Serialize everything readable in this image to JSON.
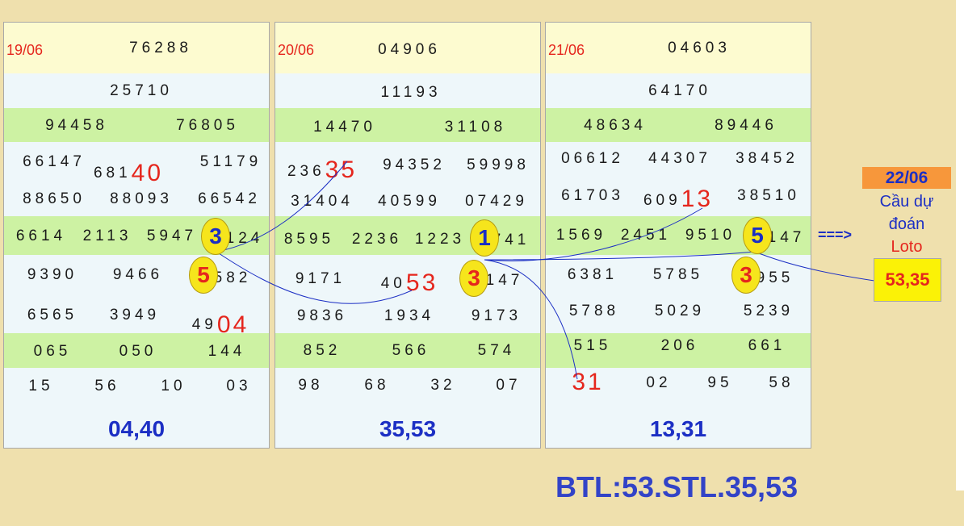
{
  "panels": [
    {
      "date": "19/06",
      "special": "76288",
      "first": "25710",
      "second": [
        "94458",
        "76805"
      ],
      "third_a": [
        "66147",
        "681",
        "40",
        "51179"
      ],
      "third_b": [
        "88650",
        "88093",
        "66542"
      ],
      "fourth": [
        "6614",
        "2113",
        "5947",
        "124"
      ],
      "fifth_a": [
        "9390",
        "9466",
        "582"
      ],
      "fifth_b": [
        "6565",
        "3949",
        "49",
        "04"
      ],
      "sixth": [
        "065",
        "050",
        "144"
      ],
      "seventh": [
        "15",
        "56",
        "10",
        "03"
      ],
      "result": "04,40",
      "ovals": [
        "3",
        "5"
      ]
    },
    {
      "date": "20/06",
      "special": "04906",
      "first": "11193",
      "second": [
        "14470",
        "31108"
      ],
      "third_a": [
        "236",
        "35",
        "94352",
        "59998"
      ],
      "third_b": [
        "31404",
        "40599",
        "07429"
      ],
      "fourth": [
        "8595",
        "2236",
        "1223",
        "741"
      ],
      "fifth_a": [
        "9171",
        "40",
        "53",
        "147"
      ],
      "fifth_b": [
        "9836",
        "1934",
        "9173"
      ],
      "sixth": [
        "852",
        "566",
        "574"
      ],
      "seventh": [
        "98",
        "68",
        "32",
        "07"
      ],
      "result": "35,53",
      "ovals": [
        "1",
        "3"
      ]
    },
    {
      "date": "21/06",
      "special": "04603",
      "first": "64170",
      "second": [
        "48634",
        "89446"
      ],
      "third_a": [
        "06612",
        "44307",
        "38452"
      ],
      "third_b": [
        "61703",
        "609",
        "13",
        "38510"
      ],
      "fourth": [
        "1569",
        "2451",
        "9510",
        "147"
      ],
      "fifth_a": [
        "6381",
        "5785",
        "955"
      ],
      "fifth_b": [
        "5788",
        "5029",
        "5239"
      ],
      "sixth": [
        "515",
        "206",
        "661"
      ],
      "seventh": [
        "31",
        "02",
        "95",
        "58"
      ],
      "result": "13,31",
      "ovals": [
        "5",
        "3"
      ]
    }
  ],
  "prediction": {
    "arrow": "===>",
    "date": "22/06",
    "line1": "Cầu dự",
    "line2": "đoán",
    "line3": "Loto",
    "value": "53,35"
  },
  "footer": "BTL:53.STL.35,53",
  "colors": {
    "background": "#efe0ad",
    "header_row": "#fdfbd0",
    "green_row": "#cdf2a3",
    "light_row": "#eef7fa",
    "red": "#e5261d",
    "blue": "#1c2fc4",
    "oval": "#f6e51c"
  }
}
